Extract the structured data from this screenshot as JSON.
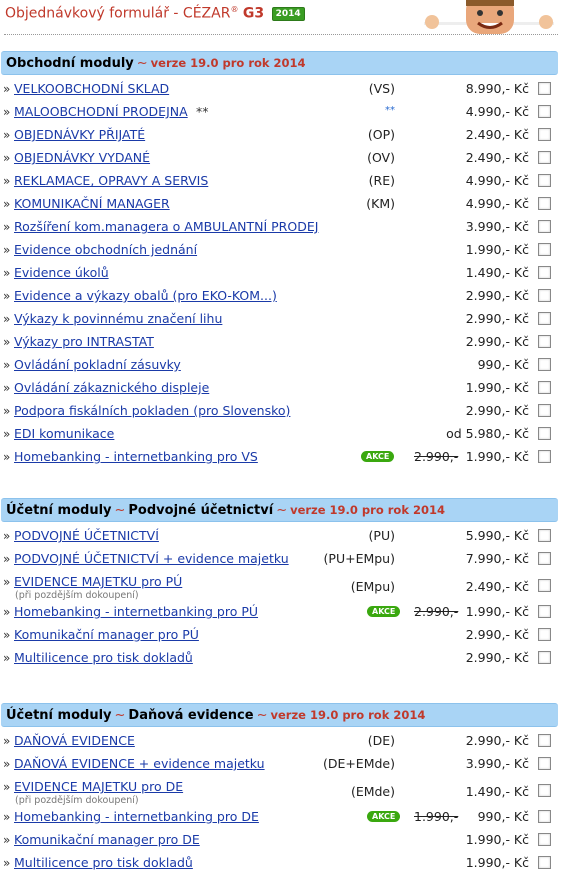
{
  "header": {
    "title_prefix": "Objednávkový formulář - CÉZAR",
    "title_reg": "®",
    "title_g3": "G3",
    "year_badge": "2014"
  },
  "sections": [
    {
      "title": "Obchodní moduly",
      "subtitle": "",
      "version": "verze 19.0 pro rok 2014",
      "items": [
        {
          "name": "VELKOOBCHODNÍ SKLAD",
          "code": "(VS)",
          "price": "8.990,- Kč"
        },
        {
          "name": "MALOOBCHODNÍ PRODEJNA",
          "star": "**",
          "code_mark": "**",
          "price": "4.990,- Kč"
        },
        {
          "name": "OBJEDNÁVKY PŘIJATÉ",
          "code": "(OP)",
          "price": "2.490,- Kč"
        },
        {
          "name": "OBJEDNÁVKY VYDANÉ",
          "code": "(OV)",
          "price": "2.490,- Kč"
        },
        {
          "name": "REKLAMACE, OPRAVY A SERVIS",
          "code": "(RE)",
          "price": "4.990,- Kč"
        },
        {
          "name": "KOMUNIKAČNÍ MANAGER",
          "code": "(KM)",
          "price": "4.990,- Kč"
        },
        {
          "name": "Rozšíření kom.managera o AMBULANTNÍ PRODEJ",
          "price": "3.990,- Kč"
        },
        {
          "name": "Evidence obchodních jednání",
          "price": "1.990,- Kč"
        },
        {
          "name": "Evidence úkolů",
          "price": "1.490,- Kč"
        },
        {
          "name": "Evidence a výkazy obalů (pro EKO-KOM...)",
          "price": "2.990,- Kč"
        },
        {
          "name": "Výkazy k povinnému značení lihu",
          "price": "2.990,- Kč"
        },
        {
          "name": "Výkazy pro INTRASTAT",
          "price": "2.990,- Kč"
        },
        {
          "name": "Ovládání pokladní zásuvky",
          "price": "990,- Kč"
        },
        {
          "name": "Ovládání zákaznického displeje",
          "price": "1.990,- Kč"
        },
        {
          "name": "Podpora fiskálních pokladen (pro Slovensko)",
          "price": "2.990,- Kč"
        },
        {
          "name": "EDI komunikace",
          "price": "od 5.980,- Kč"
        },
        {
          "name": "Homebanking - internetbanking pro VS",
          "akce": "AKCE",
          "old_price": "2.990,-",
          "price": "1.990,- Kč"
        }
      ]
    },
    {
      "title": "Účetní moduly",
      "subtitle": "Podvojné účetnictví",
      "version": "verze 19.0 pro rok 2014",
      "items": [
        {
          "name": "PODVOJNÉ ÚČETNICTVÍ",
          "code": "(PU)",
          "price": "5.990,- Kč"
        },
        {
          "name": "PODVOJNÉ ÚČETNICTVÍ + evidence majetku",
          "code": "(PU+EMpu)",
          "price": "7.990,- Kč"
        },
        {
          "name": "EVIDENCE MAJETKU pro PÚ",
          "sub": "(při pozdějším dokoupení)",
          "code": "(EMpu)",
          "price": "2.490,- Kč"
        },
        {
          "name": "Homebanking - internetbanking pro PÚ",
          "akce": "AKCE",
          "old_price": "2.990,-",
          "price": "1.990,- Kč"
        },
        {
          "name": "Komunikační manager pro PÚ",
          "price": "2.990,- Kč"
        },
        {
          "name": "Multilicence pro tisk dokladů",
          "price": "2.990,- Kč"
        }
      ]
    },
    {
      "title": "Účetní moduly",
      "subtitle": "Daňová evidence",
      "version": "verze 19.0 pro rok 2014",
      "items": [
        {
          "name": "DAŇOVÁ EVIDENCE",
          "code": "(DE)",
          "price": "2.990,- Kč"
        },
        {
          "name": "DAŇOVÁ EVIDENCE + evidence majetku",
          "code": "(DE+EMde)",
          "price": "3.990,- Kč"
        },
        {
          "name": "EVIDENCE MAJETKU pro DE",
          "sub": "(při pozdějším dokoupení)",
          "code": "(EMde)",
          "price": "1.490,- Kč"
        },
        {
          "name": "Homebanking - internetbanking pro DE",
          "akce": "AKCE",
          "old_price": "1.990,-",
          "price": "990,- Kč"
        },
        {
          "name": "Komunikační manager pro DE",
          "price": "1.990,- Kč"
        },
        {
          "name": "Multilicence pro tisk dokladů",
          "price": "1.990,- Kč"
        }
      ]
    }
  ]
}
